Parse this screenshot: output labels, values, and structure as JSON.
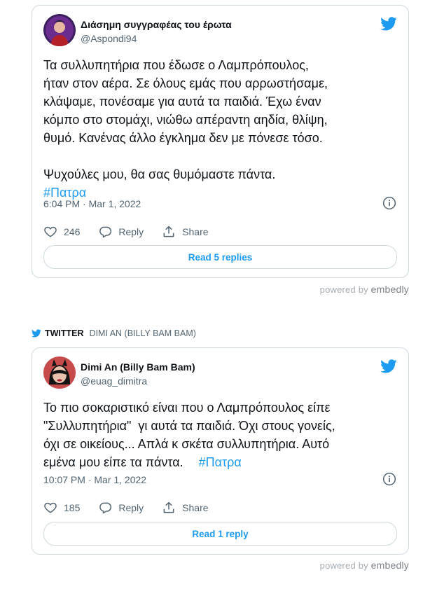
{
  "tweets": [
    {
      "author_name": "Διάσημη συγγραφέας του έρωτα",
      "handle": "@Aspondi94",
      "text_lines": [
        "Τα συλλυπητήρια που έδωσε ο Λαμπρόπουλος,",
        "ήταν στον αέρα. Σε όλους εμάς που αρρωστήσαμε,",
        "κλάψαμε, πονέσαμε για αυτά τα παιδιά. Έχω έναν",
        "κόμπο στο στομάχι, νιώθω απέραντη αηδία, θλίψη,",
        "θυμό. Κανένας άλλο έγκλημα δεν με πόνεσε τόσο."
      ],
      "text_line_extra": "Ψυχούλες μου, θα σας θυμόμαστε πάντα.",
      "hashtag": "#Πατρα",
      "timestamp": "6:04 PM · Mar 1, 2022",
      "likes": "246",
      "reply_label": "Reply",
      "share_label": "Share",
      "read_label": "Read 5 replies"
    },
    {
      "header_source": "TWITTER",
      "header_author": "DIMI AN (BILLY BAM BAM)",
      "author_name": "Dimi An (Billy Bam Bam)",
      "handle": "@euag_dimitra",
      "text_lines": [
        "Το πιο σοκαριστικό είναι που ο Λαμπρόπουλος είπε",
        "\"Συλλυπητήρια\"  γι αυτά τα παιδιά. Όχι στους γονείς,",
        "όχι σε οικείους... Απλά κ σκέτα συλλυπητήρια. Αυτό",
        "εμένα μου είπε τα πάντα."
      ],
      "hashtag": "#Πατρα",
      "timestamp": "10:07 PM · Mar 1, 2022",
      "likes": "185",
      "reply_label": "Reply",
      "share_label": "Share",
      "read_label": "Read 1 reply"
    }
  ],
  "powered": {
    "prefix": "powered by",
    "brand": "embedly"
  },
  "colors": {
    "accent": "#1d9bf0",
    "muted": "#536471",
    "border": "#cfd9de"
  },
  "icons": [
    "twitter-bird-icon",
    "info-icon",
    "heart-icon",
    "reply-icon",
    "share-icon"
  ]
}
